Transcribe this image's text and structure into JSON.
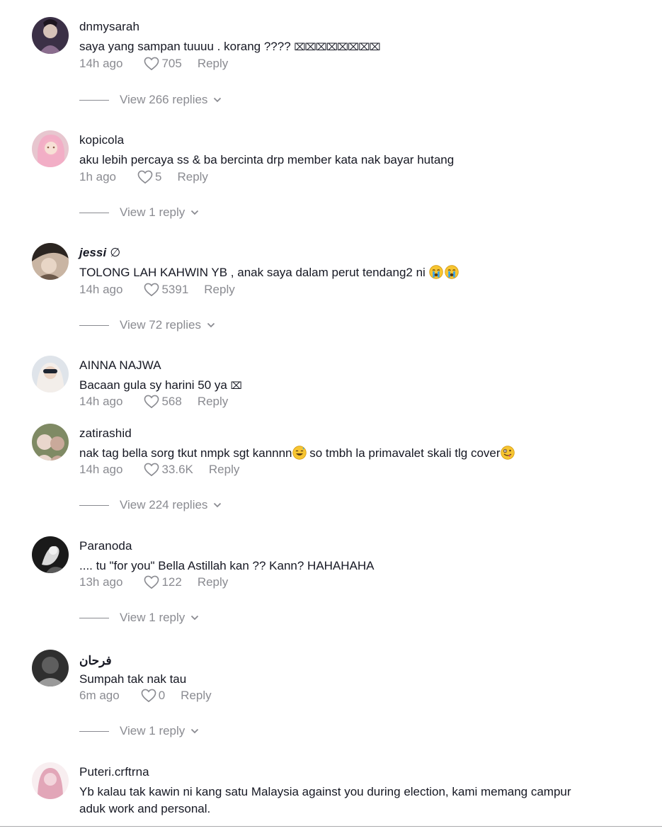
{
  "comments": [
    {
      "username": "dnmysarah",
      "text": "saya yang sampan tuuuu . korang ???? ",
      "text_suffix": "⌧⌧⌧⌧⌧⌧⌧⌧",
      "time": "14h ago",
      "likes": "705",
      "reply_label": "Reply",
      "view_replies": "View 266 replies",
      "avatar_colors": [
        "#3b3046",
        "#8a6d8e",
        "#d6c3b9"
      ]
    },
    {
      "username": "kopicola",
      "text": "aku lebih percaya ss & ba bercinta drp member kata nak bayar hutang",
      "time": "1h ago",
      "likes": "5",
      "reply_label": "Reply",
      "view_replies": "View 1 reply",
      "avatar_colors": [
        "#e7c6cf",
        "#f3a9c4",
        "#8b5b49"
      ]
    },
    {
      "username": "jessi",
      "verified_mark": "∅",
      "text": "TOLONG LAH KAHWIN YB , anak saya dalam perut tendang2 ni ",
      "emoji": [
        "😭",
        "😭"
      ],
      "time": "14h ago",
      "likes": "5391",
      "reply_label": "Reply",
      "view_replies": "View 72 replies",
      "avatar_colors": [
        "#2b2521",
        "#c9b5a3",
        "#6d5a4b"
      ]
    },
    {
      "username": "AINNA NAJWA",
      "text": "Bacaan gula sy harini 50 ya ",
      "text_suffix": "⌧",
      "time": "14h ago",
      "likes": "568",
      "reply_label": "Reply",
      "avatar_colors": [
        "#dfe4ea",
        "#1d2430",
        "#f3eeea"
      ]
    },
    {
      "username": "zatirashid",
      "text_parts": [
        "nak tag bella sorg tkut nmpk sgt kannnn",
        " so tmbh la primavalet skali tlg cover"
      ],
      "emoji": [
        "😅",
        "🤪"
      ],
      "time": "14h ago",
      "likes": "33.6K",
      "reply_label": "Reply",
      "view_replies": "View 224 replies",
      "avatar_colors": [
        "#c9a99a",
        "#7f8a64",
        "#e9d6cc"
      ]
    },
    {
      "username": "Paranoda",
      "text": ".... tu \"for you\" Bella Astillah kan ?? Kann? HAHAHAHA",
      "time": "13h ago",
      "likes": "122",
      "reply_label": "Reply",
      "view_replies": "View 1 reply",
      "avatar_colors": [
        "#1a1a1a",
        "#d9d9d9",
        "#5a5a5a"
      ]
    },
    {
      "username": "فرحان",
      "text": "Sumpah tak nak tau",
      "time": "6m ago",
      "likes": "0",
      "reply_label": "Reply",
      "view_replies": "View 1 reply",
      "avatar_colors": [
        "#2f2f2f",
        "#9a9a9a",
        "#5e5e5e"
      ]
    },
    {
      "username": "Puteri.crftrna",
      "text": "Yb kalau tak kawin ni kang satu Malaysia against you during election, kami memang campur aduk work and personal.",
      "avatar_colors": [
        "#f3d5dc",
        "#e2a6b8",
        "#f8eef0"
      ]
    }
  ],
  "colors": {
    "text": "#161823",
    "muted": "#8a8b91",
    "background": "#ffffff"
  },
  "icons": {
    "like": "heart-outline-icon",
    "expand": "chevron-down-icon"
  }
}
